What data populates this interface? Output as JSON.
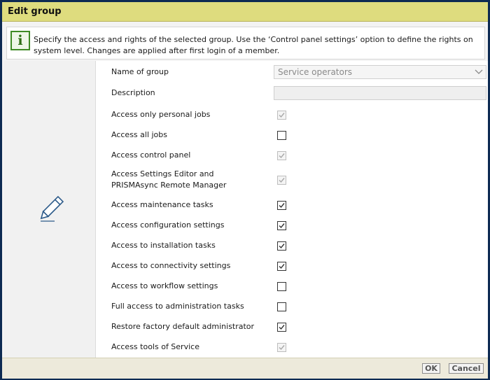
{
  "dialog": {
    "title": "Edit group",
    "info_line1": "Specify the access and rights of the selected group. Use the ‘Control panel settings’ option to define the rights on",
    "info_line2": "system level. Changes are applied after first login of a member."
  },
  "icons": {
    "info": "info-icon",
    "edit": "pencil-icon",
    "dropdown": "chevron-down-icon",
    "check": "check-icon"
  },
  "form": {
    "name_label": "Name of group",
    "name_value": "Service operators",
    "description_label": "Description",
    "description_value": "",
    "permissions": [
      {
        "label": "Access only personal jobs",
        "checked": true,
        "disabled": true
      },
      {
        "label": "Access all jobs",
        "checked": false,
        "disabled": false
      },
      {
        "label": "Access control panel",
        "checked": true,
        "disabled": true
      },
      {
        "label": "Access Settings Editor and",
        "label2": "PRISMAsync Remote Manager",
        "checked": true,
        "disabled": true
      },
      {
        "label": "Access maintenance tasks",
        "checked": true,
        "disabled": false
      },
      {
        "label": "Access configuration settings",
        "checked": true,
        "disabled": false
      },
      {
        "label": "Access to installation tasks",
        "checked": true,
        "disabled": false
      },
      {
        "label": "Access to connectivity settings",
        "checked": true,
        "disabled": false
      },
      {
        "label": "Access to workflow settings",
        "checked": false,
        "disabled": false
      },
      {
        "label": "Full access to administration tasks",
        "checked": false,
        "disabled": false
      },
      {
        "label": "Restore factory default administrator",
        "checked": true,
        "disabled": false
      },
      {
        "label": "Access tools of Service",
        "checked": true,
        "disabled": true
      }
    ]
  },
  "footer": {
    "ok_label": "OK",
    "cancel_label": "Cancel"
  },
  "colors": {
    "titlebar": "#dedc7e",
    "border": "#0d2a52",
    "info_green": "#3f8a25",
    "footer": "#edeadb"
  }
}
